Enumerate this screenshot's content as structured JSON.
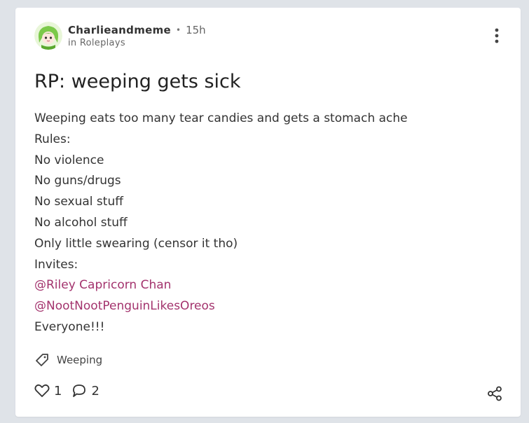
{
  "post": {
    "author": "Charlieandmeme",
    "separator": "•",
    "time": "15h",
    "community": "in Roleplays",
    "title": "RP: weeping gets sick",
    "body_lines": [
      "Weeping eats too many tear candies and gets a stomach ache",
      "Rules:",
      "No violence",
      "No guns/drugs",
      "No sexual stuff",
      "No alcohol stuff",
      "Only little swearing (censor it tho)",
      "Invites:"
    ],
    "mentions": [
      "@Riley Capricorn Chan",
      "@NootNootPenguinLikesOreos"
    ],
    "closing_line": "Everyone!!!",
    "tag": "Weeping",
    "likes": "1",
    "comments": "2"
  },
  "icons": {
    "avatar": "avatar-image",
    "more": "more-vertical-icon",
    "tag": "tag-icon",
    "like": "heart-icon",
    "comment": "comment-bubble-icon",
    "share": "share-icon"
  },
  "colors": {
    "page_background": "#dfe3e8",
    "card_background": "#ffffff",
    "mention": "#a3336d",
    "text": "#333333"
  }
}
